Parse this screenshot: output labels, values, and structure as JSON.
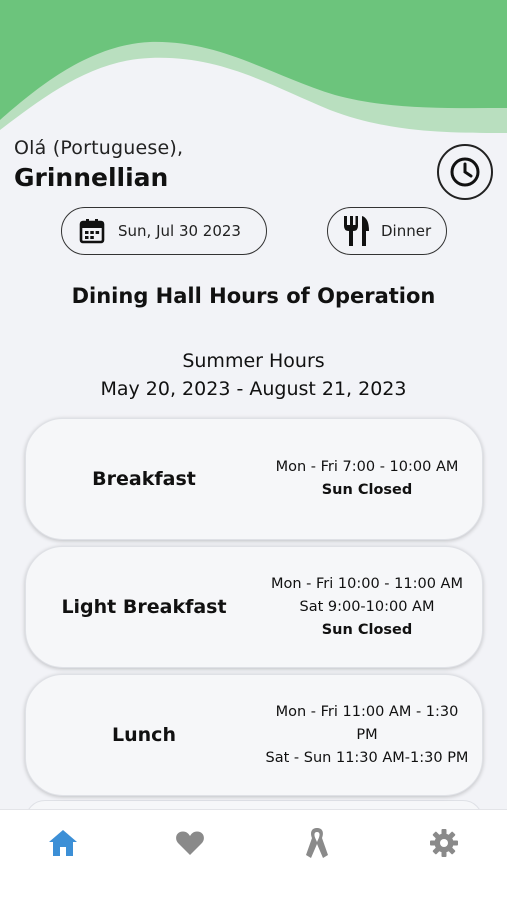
{
  "greeting": {
    "hello": "Olá (Portuguese),",
    "name": "Grinnellian"
  },
  "controls": {
    "date_label": "Sun, Jul 30 2023",
    "meal_label": "Dinner"
  },
  "section_title": "Dining Hall Hours of Operation",
  "season": {
    "name": "Summer Hours",
    "range": "May 20, 2023 - August 21, 2023"
  },
  "meals": [
    {
      "name": "Breakfast",
      "lines": [
        "Mon - Fri 7:00 - 10:00 AM",
        "Sun Closed"
      ]
    },
    {
      "name": "Light Breakfast",
      "lines": [
        "Mon - Fri 10:00 - 11:00 AM",
        "Sat 9:00-10:00 AM",
        "Sun Closed"
      ]
    },
    {
      "name": "Lunch",
      "lines": [
        "Mon - Fri 11:00 AM - 1:30",
        "PM",
        "Sat - Sun 11:30 AM-1:30 PM"
      ]
    }
  ],
  "nav": {
    "items": [
      "home-icon",
      "heart-icon",
      "ribbon-icon",
      "gear-icon"
    ],
    "active": "home-icon"
  },
  "colors": {
    "header_green": "#6cc47c",
    "header_light": "#b9dfbf",
    "active_nav": "#3c8fd6",
    "inactive_nav": "#8a8a8a"
  }
}
